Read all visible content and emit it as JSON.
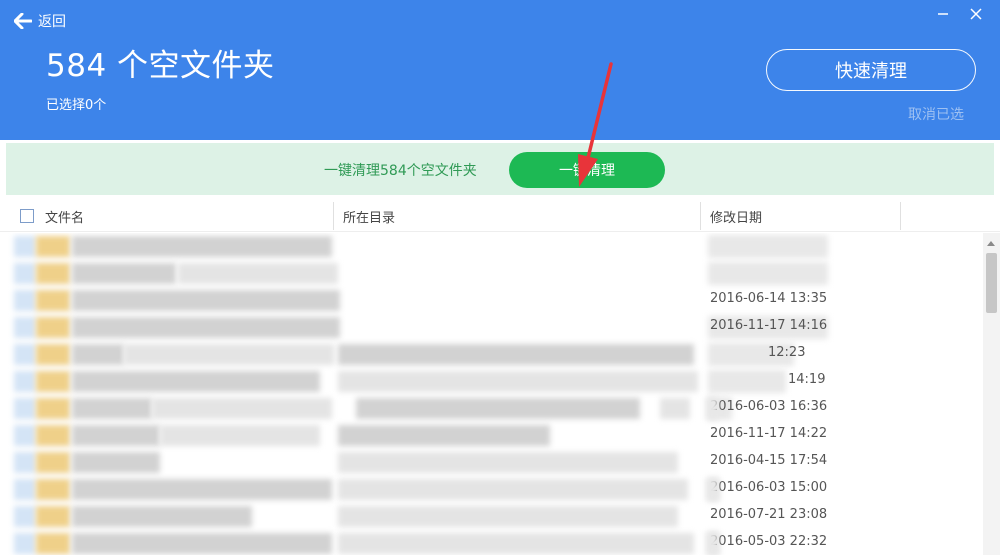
{
  "header": {
    "back_label": "返回",
    "title": "584 个空文件夹",
    "selected_text": "已选择0个",
    "quick_clean_label": "快速清理",
    "cancel_selection_label": "取消已选"
  },
  "banner": {
    "text": "一键清理584个空文件夹",
    "button_label": "一键清理"
  },
  "table": {
    "columns": [
      "文件名",
      "所在目录",
      "修改日期"
    ],
    "rows": [
      {
        "date": ""
      },
      {
        "date": ""
      },
      {
        "date": "2016-06-14 13:35"
      },
      {
        "date": "2016-11-17 14:16"
      },
      {
        "date": "12:23"
      },
      {
        "date": "14:19"
      },
      {
        "date": "2016-06-03 16:36"
      },
      {
        "date": "2016-11-17 14:22"
      },
      {
        "date": "2016-04-15 17:54"
      },
      {
        "date": "2016-06-03 15:00"
      },
      {
        "date": "2016-07-21 23:08"
      },
      {
        "date": "2016-05-03 22:32"
      }
    ]
  },
  "colors": {
    "header_blue": "#3d84ea",
    "banner_green_bg": "#ddf2e6",
    "button_green": "#1db954",
    "annotation_red": "#e8343a"
  },
  "icons": [
    "back-arrow-icon",
    "minimize-icon",
    "close-icon",
    "checkbox"
  ]
}
